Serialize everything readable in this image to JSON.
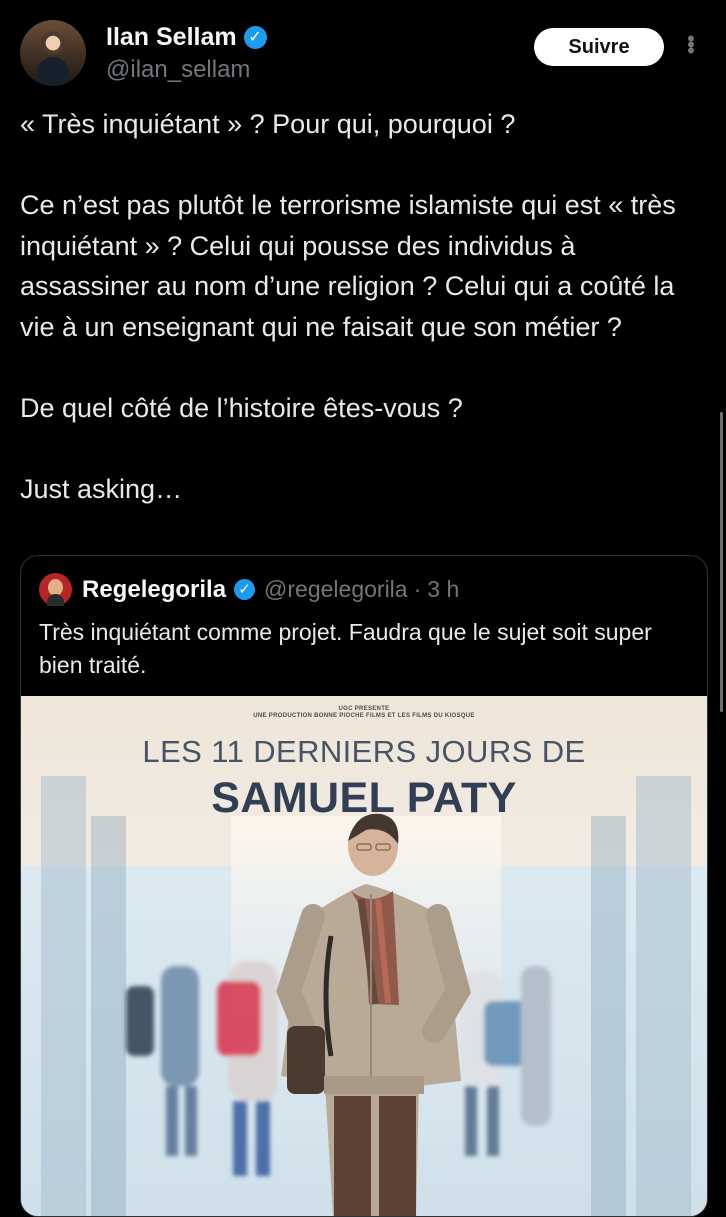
{
  "author": {
    "name": "Ilan Sellam",
    "handle": "@ilan_sellam",
    "verified_icon": "✓",
    "follow_label": "Suivre",
    "more_icon": "⋮"
  },
  "tweet": {
    "paragraphs": [
      "« Très inquiétant » ? Pour qui, pourquoi ?",
      "Ce n’est pas plutôt le terrorisme islamiste qui est « très inquiétant » ? Celui qui pousse des individus à assassiner au nom d’une religion ? Celui qui a coûté la vie à un enseignant qui ne faisait que son métier ?",
      "De quel côté de l’histoire êtes-vous ?",
      "Just asking…"
    ]
  },
  "quote": {
    "name": "Regelegorila",
    "verified_icon": "✓",
    "handle": "@regelegorila",
    "separator": "·",
    "time": "3 h",
    "text": "Très inquiétant comme projet. Faudra que le sujet soit super bien traité."
  },
  "poster": {
    "credit_line_1": "UGC PRESENTE",
    "credit_line_2": "UNE PRODUCTION BONNE PIOCHE FILMS ET LES FILMS DU KIOSQUE",
    "title_line_1": "LES 11 DERNIERS JOURS DE",
    "title_line_2": "SAMUEL PATY",
    "description": "Film poster showing a man in a beige coat and scarf walking through a school hallway"
  },
  "colors": {
    "background": "#000000",
    "text": "#e7e9ea",
    "secondary_text": "#71767b",
    "verified": "#1d9bf0",
    "border": "#2f3336"
  }
}
